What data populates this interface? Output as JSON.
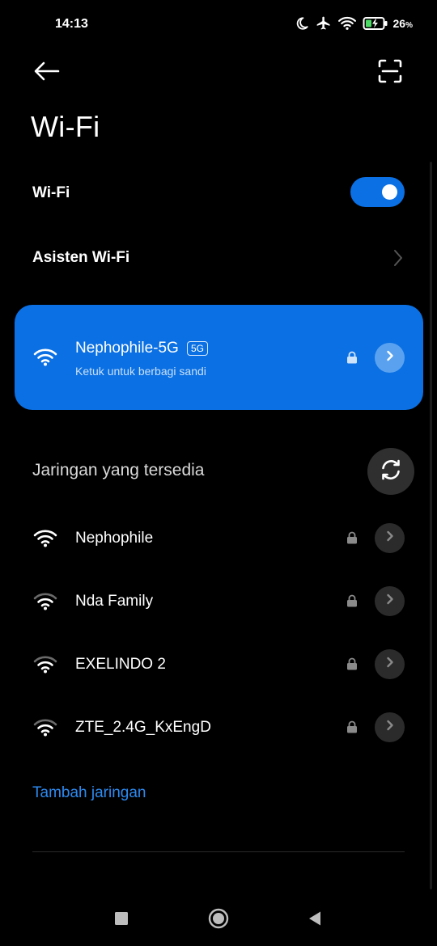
{
  "status_bar": {
    "time": "14:13",
    "battery_percent": "26",
    "battery_suffix": "%",
    "icons": [
      "moon-icon",
      "airplane-icon",
      "wifi-icon",
      "battery-charging-icon"
    ]
  },
  "header": {
    "back_icon": "arrow-left-icon",
    "scan_icon": "scan-qr-icon"
  },
  "page": {
    "title": "Wi-Fi"
  },
  "settings": {
    "wifi_label": "Wi-Fi",
    "wifi_enabled": true,
    "assistant_label": "Asisten Wi-Fi"
  },
  "connected": {
    "name": "Nephophile-5G",
    "badge": "5G",
    "subtitle": "Ketuk untuk berbagi sandi",
    "secured": true
  },
  "available": {
    "title": "Jaringan yang tersedia",
    "networks": [
      {
        "name": "Nephophile",
        "secured": true
      },
      {
        "name": "Nda Family",
        "secured": true
      },
      {
        "name": "EXELINDO 2",
        "secured": true
      },
      {
        "name": "ZTE_2.4G_KxEngD",
        "secured": true
      }
    ]
  },
  "add_network_label": "Tambah jaringan",
  "colors": {
    "accent": "#0a70e3",
    "link": "#2d8af0",
    "background": "#000000"
  },
  "nav_bar": {
    "icons": [
      "recents-square-icon",
      "home-circle-icon",
      "back-triangle-icon"
    ]
  }
}
